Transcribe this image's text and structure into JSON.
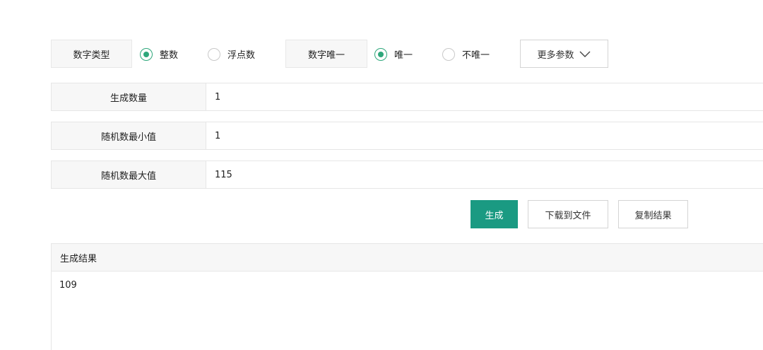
{
  "options": {
    "number_type": {
      "label": "数字类型",
      "choices": [
        {
          "label": "整数",
          "selected": true
        },
        {
          "label": "浮点数",
          "selected": false
        }
      ]
    },
    "number_unique": {
      "label": "数字唯一",
      "choices": [
        {
          "label": "唯一",
          "selected": true
        },
        {
          "label": "不唯一",
          "selected": false
        }
      ]
    },
    "more_params_label": "更多参数"
  },
  "fields": [
    {
      "label": "生成数量",
      "value": "1"
    },
    {
      "label": "随机数最小值",
      "value": "1"
    },
    {
      "label": "随机数最大值",
      "value": "115"
    }
  ],
  "actions": {
    "generate": "生成",
    "download": "下载到文件",
    "copy": "复制结果"
  },
  "result": {
    "title": "生成结果",
    "value": "109"
  },
  "colors": {
    "accent": "#2ea77b",
    "primary_button": "#1a9a82"
  }
}
